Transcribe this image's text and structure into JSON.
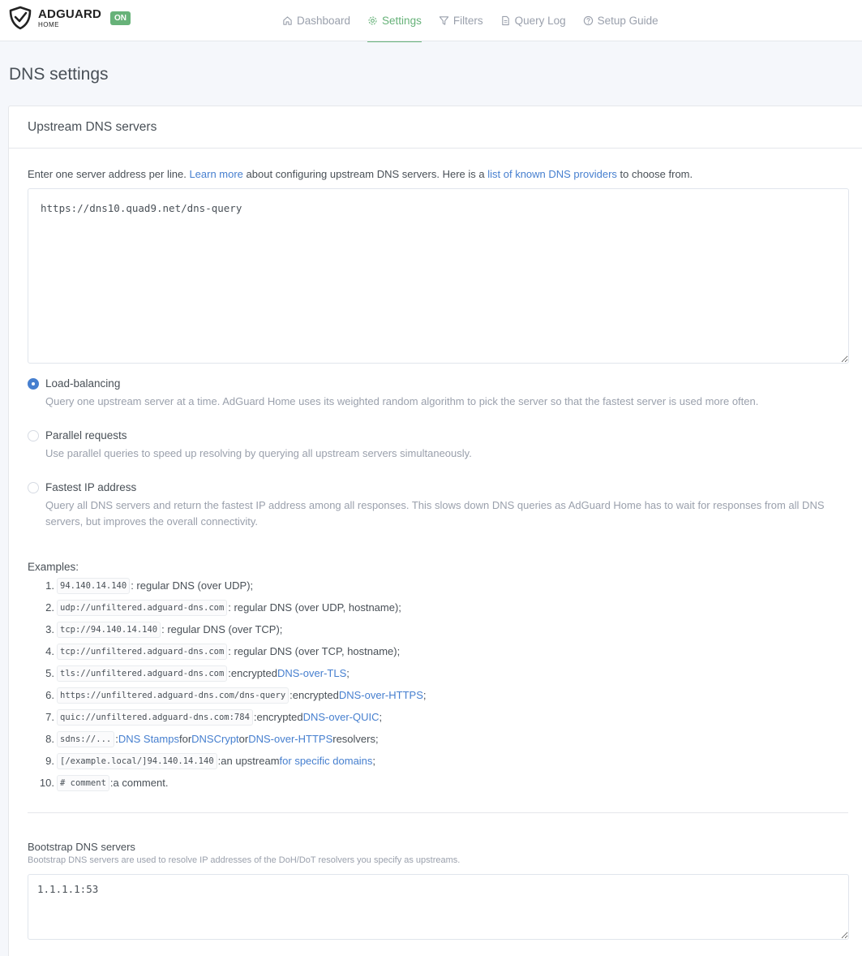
{
  "app": {
    "logo_title": "ADGUARD",
    "logo_sub": "HOME",
    "status_badge": "ON",
    "accent_color": "#67b279",
    "link_color": "#467fcf"
  },
  "nav": [
    {
      "label": "Dashboard",
      "icon": "home-icon",
      "active": false
    },
    {
      "label": "Settings",
      "icon": "gear-icon",
      "active": true
    },
    {
      "label": "Filters",
      "icon": "filter-icon",
      "active": false
    },
    {
      "label": "Query Log",
      "icon": "document-icon",
      "active": false
    },
    {
      "label": "Setup Guide",
      "icon": "help-circle-icon",
      "active": false
    }
  ],
  "page_title": "DNS settings",
  "upstream": {
    "card_title": "Upstream DNS servers",
    "intro": {
      "part1": "Enter one server address per line. ",
      "learn_more": "Learn more",
      "part2": " about configuring upstream DNS servers. Here is a ",
      "providers_link": "list of known DNS providers",
      "part3": " to choose from."
    },
    "textarea_value": "https://dns10.quad9.net/dns-query",
    "modes": [
      {
        "label": "Load-balancing",
        "desc": "Query one upstream server at a time. AdGuard Home uses its weighted random algorithm to pick the server so that the fastest server is used more often.",
        "checked": true
      },
      {
        "label": "Parallel requests",
        "desc": "Use parallel queries to speed up resolving by querying all upstream servers simultaneously.",
        "checked": false
      },
      {
        "label": "Fastest IP address",
        "desc": "Query all DNS servers and return the fastest IP address among all responses. This slows down DNS queries as AdGuard Home has to wait for responses from all DNS servers, but improves the overall connectivity.",
        "checked": false
      }
    ],
    "examples_title": "Examples:",
    "examples": [
      {
        "num": "1.",
        "code": "94.140.14.140",
        "text": ": regular DNS (over UDP);"
      },
      {
        "num": "2.",
        "code": "udp://unfiltered.adguard-dns.com",
        "text": ": regular DNS (over UDP, hostname);"
      },
      {
        "num": "3.",
        "code": "tcp://94.140.14.140",
        "text": ": regular DNS (over TCP);"
      },
      {
        "num": "4.",
        "code": "tcp://unfiltered.adguard-dns.com",
        "text": ": regular DNS (over TCP, hostname);"
      },
      {
        "num": "5.",
        "code": "tls://unfiltered.adguard-dns.com",
        "pre": ":encrypted ",
        "link1": "DNS-over-TLS",
        "post": ";"
      },
      {
        "num": "6.",
        "code": "https://unfiltered.adguard-dns.com/dns-query",
        "pre": ":encrypted ",
        "link1": "DNS-over-HTTPS",
        "post": ";"
      },
      {
        "num": "7.",
        "code": "quic://unfiltered.adguard-dns.com:784",
        "pre": ":encrypted ",
        "link1": "DNS-over-QUIC",
        "post": ";"
      },
      {
        "num": "8.",
        "code": "sdns://...",
        "pre": ":",
        "link1": "DNS Stamps",
        "mid1": " for ",
        "link2": "DNSCrypt",
        "mid2": " or ",
        "link3": "DNS-over-HTTPS",
        "post": " resolvers;"
      },
      {
        "num": "9.",
        "code": "[/example.local/]94.140.14.140",
        "pre": ":an upstream ",
        "link1": "for specific domains",
        "post": ";"
      },
      {
        "num": "10.",
        "code": "# comment",
        "text": ":a comment."
      }
    ]
  },
  "bootstrap": {
    "title": "Bootstrap DNS servers",
    "desc": "Bootstrap DNS servers are used to resolve IP addresses of the DoH/DoT resolvers you specify as upstreams.",
    "textarea_value": "1.1.1.1:53"
  }
}
